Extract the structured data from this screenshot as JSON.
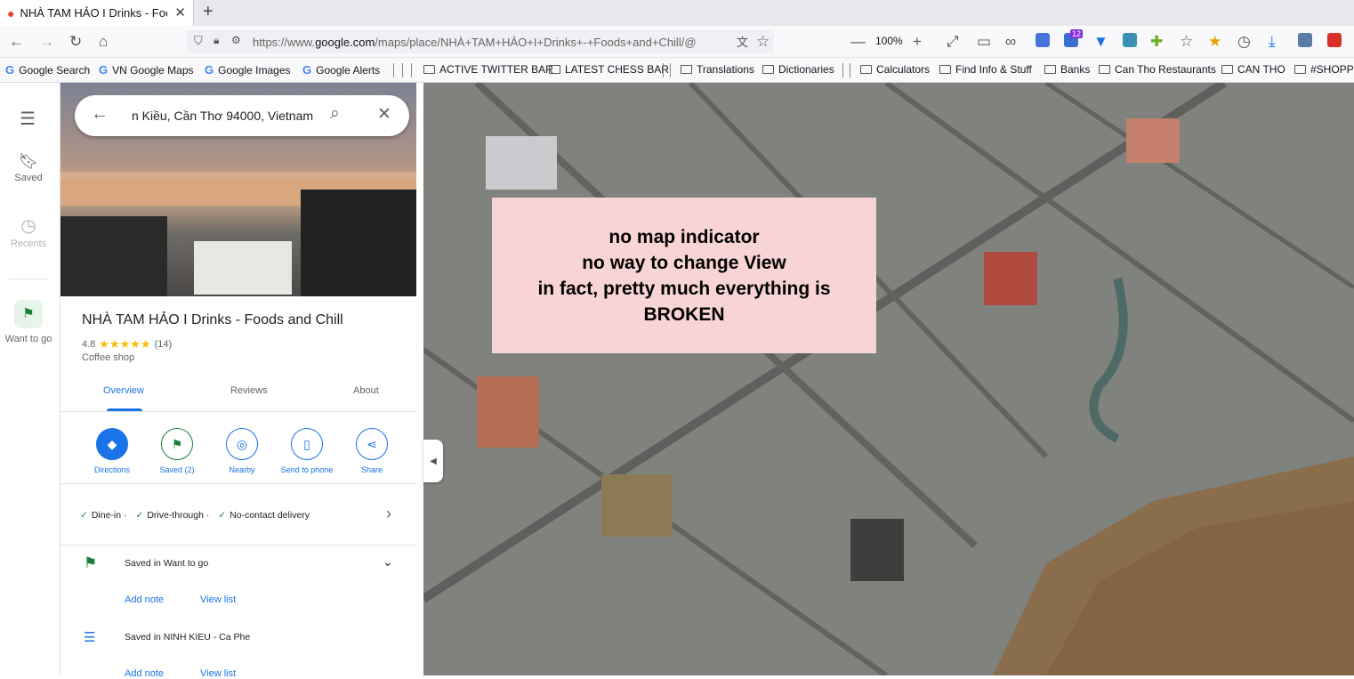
{
  "browser": {
    "tab_title": "NHÀ TAM HẢO I Drinks - Foods",
    "url_prefix": "https://www.",
    "url_domain": "google.com",
    "url_rest": "/maps/place/NHÀ+TAM+HẢO+I+Drinks+-+Foods+and+Chill/@",
    "zoom": "100%",
    "notification_count": "12"
  },
  "bookmarks": [
    {
      "label": "Google Search",
      "icon": "google-icon"
    },
    {
      "label": "VN Google Maps",
      "icon": "google-icon"
    },
    {
      "label": "Google Images",
      "icon": "google-icon"
    },
    {
      "label": "Google Alerts",
      "icon": "google-icon"
    },
    {
      "label": "ACTIVE TWITTER BAR",
      "icon": "folder-icon"
    },
    {
      "label": "LATEST CHESS BAR",
      "icon": "folder-icon"
    },
    {
      "label": "Translations",
      "icon": "folder-icon"
    },
    {
      "label": "Dictionaries",
      "icon": "folder-icon"
    },
    {
      "label": "Calculators",
      "icon": "folder-icon"
    },
    {
      "label": "Find Info & Stuff",
      "icon": "folder-icon"
    },
    {
      "label": "Banks",
      "icon": "folder-icon"
    },
    {
      "label": "Can Tho Restaurants",
      "icon": "folder-icon"
    },
    {
      "label": "CAN THO",
      "icon": "folder-icon"
    },
    {
      "label": "#SHOPPI",
      "icon": "folder-icon"
    }
  ],
  "rail": {
    "saved": "Saved",
    "recents": "Recents",
    "want_to_go": "Want to go"
  },
  "search": {
    "query": "n Kiều, Cần Thơ 94000, Vietnam"
  },
  "place": {
    "name": "NHÀ TAM HẢO I Drinks - Foods and Chill",
    "rating": "4.8",
    "stars": "★★★★★",
    "review_count": "(14)",
    "category": "Coffee shop"
  },
  "tabs": {
    "overview": "Overview",
    "reviews": "Reviews",
    "about": "About"
  },
  "actions": {
    "directions": "Directions",
    "saved": "Saved (2)",
    "nearby": "Nearby",
    "send": "Send to phone",
    "share": "Share"
  },
  "features": {
    "dine_in": "Dine-in ·",
    "drive_through": "Drive-through ·",
    "no_contact": "No-contact delivery"
  },
  "lists": [
    {
      "label": "Saved in Want to go",
      "add_note": "Add note",
      "view_list": "View list"
    },
    {
      "label": "Saved in NINH KIEU - Ca Phe",
      "add_note": "Add note",
      "view_list": "View list"
    }
  ],
  "note": {
    "line1": "no map indicator",
    "line2": "no way to change View",
    "line3": "in fact, pretty much everything is",
    "line4": "BROKEN"
  },
  "colors": {
    "accent": "#1a73e8",
    "green": "#188038",
    "note_bg": "#f9d4d4",
    "star": "#fbbc04"
  }
}
